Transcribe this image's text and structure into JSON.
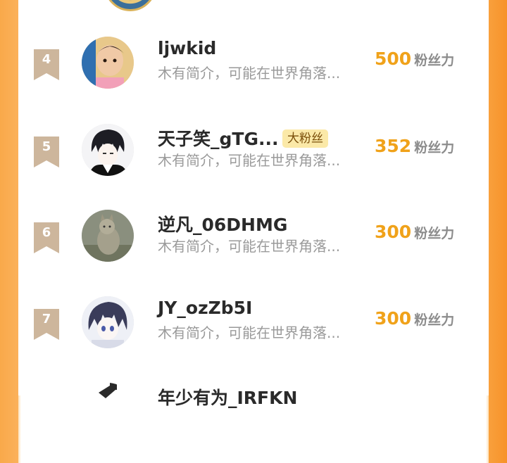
{
  "fans": [
    {
      "rank": "4",
      "name": "ljwkid",
      "badge": "",
      "bio": "木有简介，可能在世界角落...",
      "points": "500",
      "unit": "粉丝力"
    },
    {
      "rank": "5",
      "name": "天子笑_gTG...",
      "badge": "大粉丝",
      "bio": "木有简介，可能在世界角落...",
      "points": "352",
      "unit": "粉丝力"
    },
    {
      "rank": "6",
      "name": "逆凡_06DHMG",
      "badge": "",
      "bio": "木有简介，可能在世界角落...",
      "points": "300",
      "unit": "粉丝力"
    },
    {
      "rank": "7",
      "name": "JY_ozZb5I",
      "badge": "",
      "bio": "木有简介，可能在世界角落...",
      "points": "300",
      "unit": "粉丝力"
    },
    {
      "rank": "",
      "name": "年少有为_IRFKN",
      "badge": "",
      "bio": "",
      "points": "",
      "unit": ""
    }
  ],
  "colors": {
    "rank_ribbon": "#cdb69c",
    "points": "#f0a21a",
    "frame": "#f9a03c"
  }
}
